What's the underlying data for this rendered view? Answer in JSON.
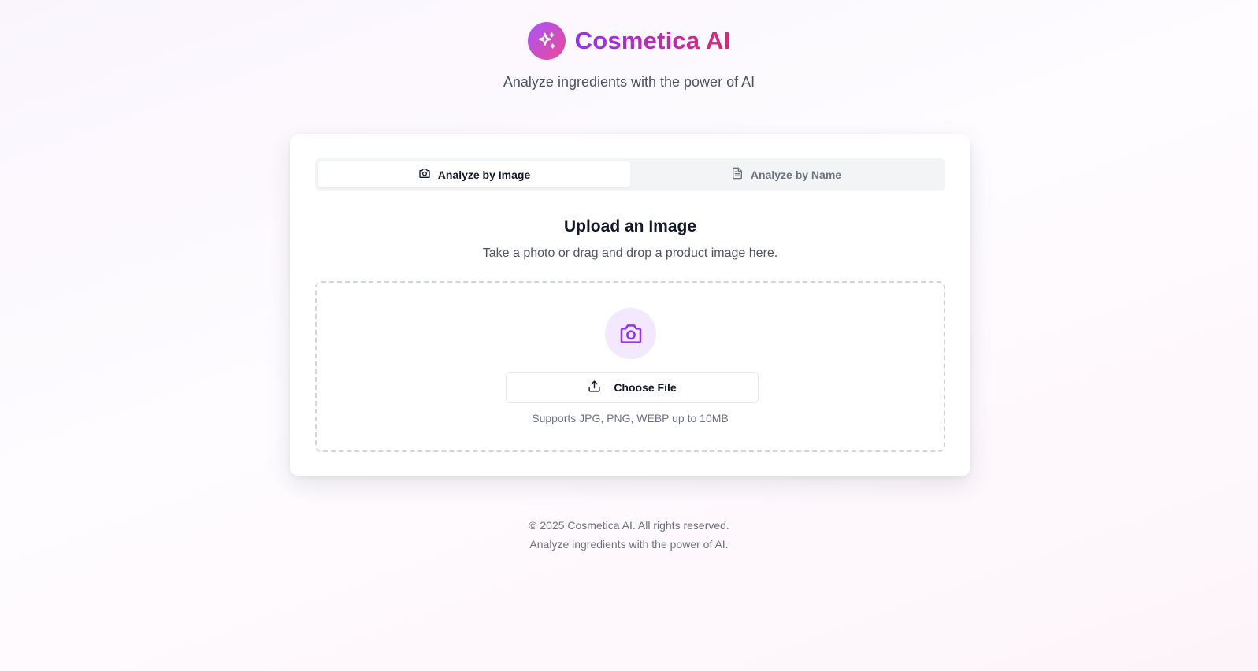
{
  "header": {
    "logo_icon": "sparkles-icon",
    "title": "Cosmetica AI",
    "tagline": "Analyze ingredients with the power of AI"
  },
  "tabs": [
    {
      "label": "Analyze by Image",
      "icon": "camera-icon",
      "active": true
    },
    {
      "label": "Analyze by Name",
      "icon": "file-text-icon",
      "active": false
    }
  ],
  "upload": {
    "title": "Upload an Image",
    "subtitle": "Take a photo or drag and drop a product image here.",
    "icon": "camera-icon",
    "button_label": "Choose File",
    "button_icon": "upload-icon",
    "supports_text": "Supports JPG, PNG, WEBP up to 10MB"
  },
  "footer": {
    "copyright": "© 2025 Cosmetica AI. All rights reserved.",
    "tagline": "Analyze ingredients with the power of AI."
  },
  "colors": {
    "brand_gradient_start": "#a855f7",
    "brand_gradient_end": "#ec4899",
    "accent_purple": "#9333ea",
    "icon_bg": "#f3e8ff"
  }
}
